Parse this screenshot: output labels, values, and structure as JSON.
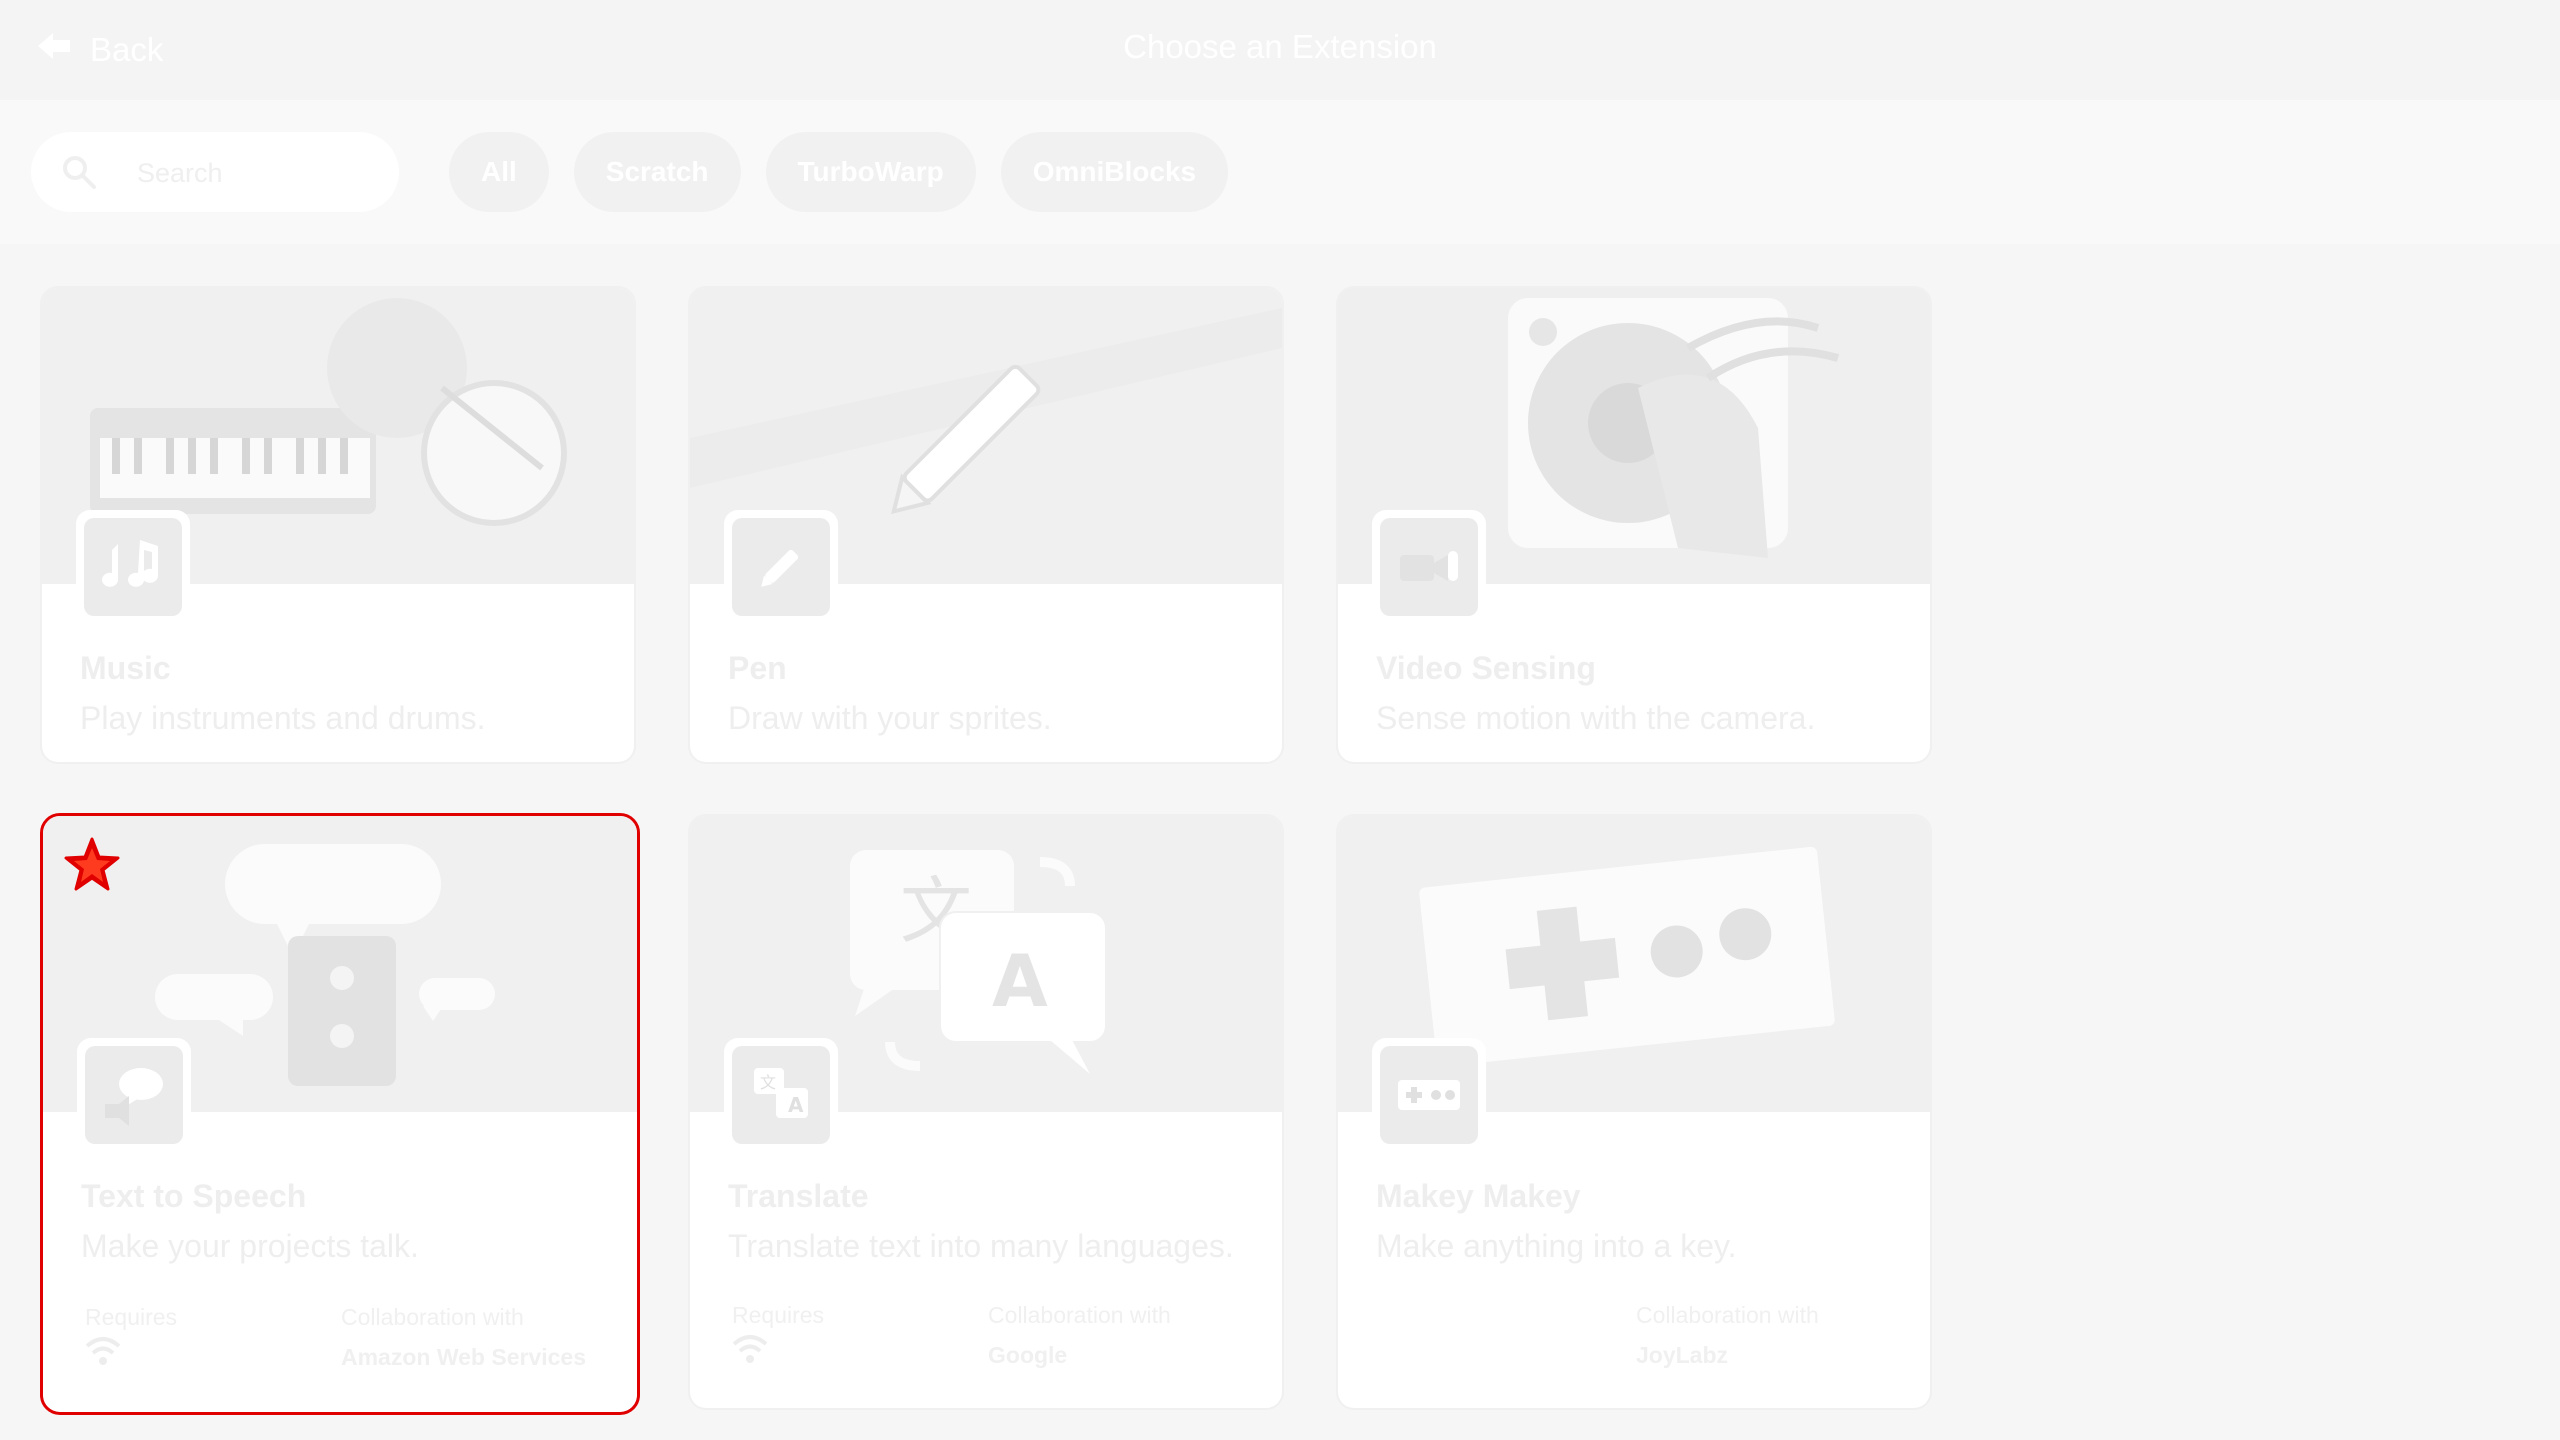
{
  "header": {
    "back_label": "Back",
    "title": "Choose an Extension"
  },
  "filter": {
    "search_placeholder": "Search",
    "chips": [
      "All",
      "Scratch",
      "TurboWarp",
      "OmniBlocks"
    ]
  },
  "extensions": [
    {
      "name": "Music",
      "description": "Play instruments and drums.",
      "icon": "music-notes-icon"
    },
    {
      "name": "Pen",
      "description": "Draw with your sprites.",
      "icon": "pencil-icon"
    },
    {
      "name": "Video Sensing",
      "description": "Sense motion with the camera.",
      "icon": "video-camera-icon"
    },
    {
      "name": "Text to Speech",
      "description": "Make your projects talk.",
      "icon": "speech-bubble-icon",
      "requires_label": "Requires",
      "collab_label": "Collaboration with",
      "collab": "Amazon Web Services",
      "favorite": true
    },
    {
      "name": "Translate",
      "description": "Translate text into many languages.",
      "icon": "translate-icon",
      "requires_label": "Requires",
      "collab_label": "Collaboration with",
      "collab": "Google"
    },
    {
      "name": "Makey Makey",
      "description": "Make anything into a key.",
      "icon": "gamepad-icon",
      "collab_label": "Collaboration with",
      "collab": "JoyLabz"
    }
  ],
  "colors": {
    "selected_border": "#e00000",
    "favorite_star": "#e00000"
  }
}
